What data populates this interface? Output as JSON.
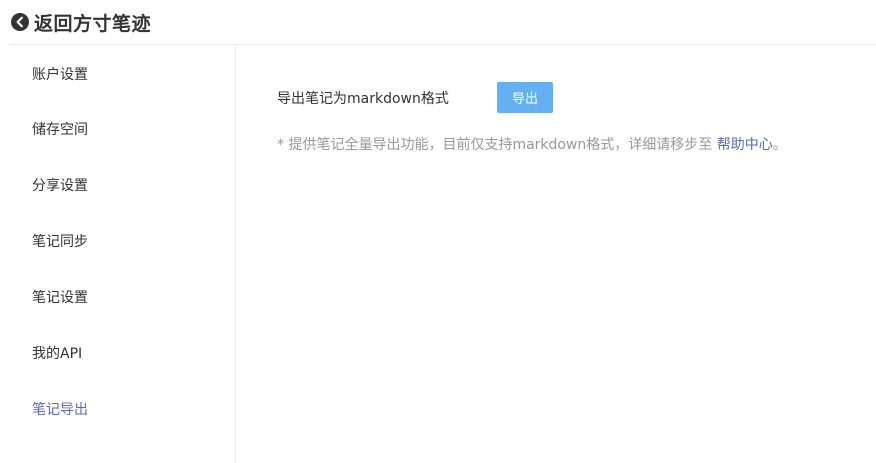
{
  "header": {
    "title": "返回方寸笔迹",
    "icon": "chevron-left-circle-icon"
  },
  "sidebar": {
    "items": [
      {
        "label": "账户设置",
        "active": false
      },
      {
        "label": "储存空间",
        "active": false
      },
      {
        "label": "分享设置",
        "active": false
      },
      {
        "label": "笔记同步",
        "active": false
      },
      {
        "label": "笔记设置",
        "active": false
      },
      {
        "label": "我的API",
        "active": false
      },
      {
        "label": "笔记导出",
        "active": true
      }
    ],
    "active_color": "#5c6bc0"
  },
  "main": {
    "export_label": "导出笔记为markdown格式",
    "export_button": "导出",
    "export_button_color": "#64b0f2",
    "note_text": "* 提供笔记全量导出功能，目前仅支持markdown格式，详细请移步至 ",
    "help_link": "帮助中心",
    "note_end": "。"
  }
}
